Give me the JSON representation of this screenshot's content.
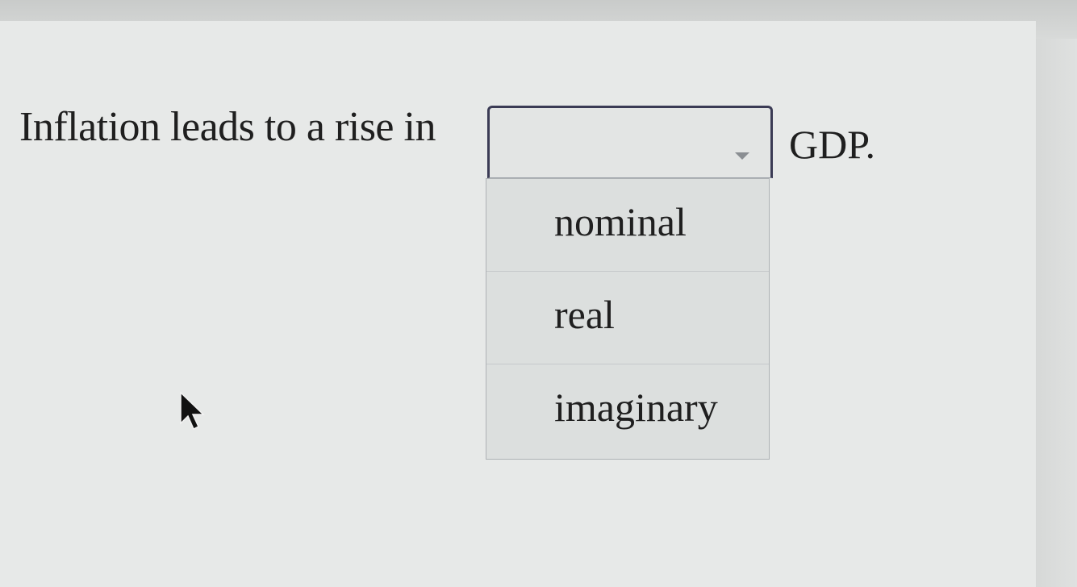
{
  "question": {
    "prefix": "Inflation leads to a rise in",
    "suffix": "GDP.",
    "select": {
      "selected_value": "",
      "caret_icon": "chevron-down-icon",
      "options": [
        "nominal",
        "real",
        "imaginary"
      ]
    }
  },
  "cursor_icon": "mouse-pointer-icon",
  "colors": {
    "page_background": "#e7e9e8",
    "select_border": "#3b3b55",
    "dropdown_background": "#dcdfde",
    "text": "#1f1f1f"
  }
}
